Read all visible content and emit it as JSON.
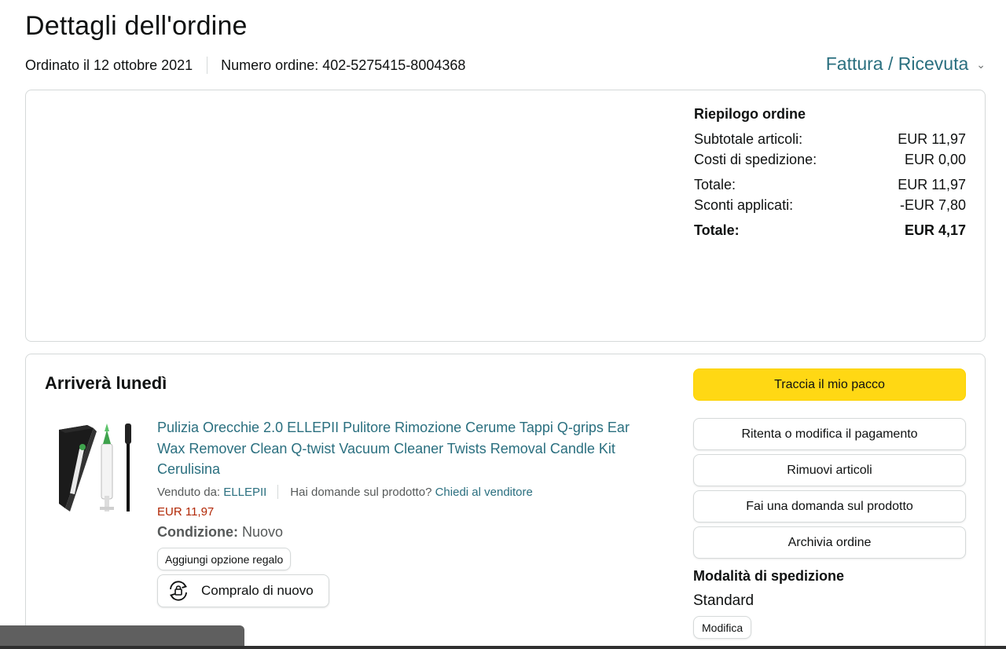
{
  "header": {
    "title": "Dettagli dell'ordine",
    "order_date": "Ordinato il 12 ottobre 2021",
    "order_number": "Numero ordine: 402-5275415-8004368",
    "invoice_link": "Fattura / Ricevuta",
    "invoice_icon": "chevron-down-icon"
  },
  "summary": {
    "title": "Riepilogo ordine",
    "rows": [
      {
        "label": "Subtotale articoli:",
        "value": "EUR 11,97"
      },
      {
        "label": "Costi di spedizione:",
        "value": "EUR 0,00"
      },
      {
        "label": "Totale:",
        "value": "EUR 11,97"
      },
      {
        "label": "Sconti applicati:",
        "value": "-EUR 7,80"
      }
    ],
    "grand_total": {
      "label": "Totale:",
      "value": "EUR 4,17"
    }
  },
  "shipment": {
    "arrival": "Arriverà lunedì",
    "product": {
      "title": "Pulizia Orecchie 2.0 ELLEPII Pulitore Rimozione Cerume Tappi Q-grips Ear Wax Remover Clean Q-twist Vacuum Cleaner Twists Removal Candle Kit Cerulisina",
      "sold_by_label": "Venduto da:",
      "seller": "ELLEPII",
      "question_label": "Hai domande sul prodotto?",
      "ask_seller": "Chiedi al venditore",
      "price": "EUR 11,97",
      "condition_label": "Condizione:",
      "condition_value": "Nuovo",
      "gift_button": "Aggiungi opzione regalo",
      "rebuy_button": "Compralo di nuovo",
      "rebuy_icon": "rebuy-icon"
    },
    "actions": {
      "track": "Traccia il mio pacco",
      "retry_payment": "Ritenta o modifica il pagamento",
      "remove_items": "Rimuovi articoli",
      "ask_question": "Fai una domanda sul prodotto",
      "archive": "Archivia ordine"
    },
    "shipping_method": {
      "title": "Modalità di spedizione",
      "value": "Standard",
      "modify_button": "Modifica"
    }
  },
  "colors": {
    "link": "#2a6f7f",
    "price": "#b12704",
    "primary_button": "#ffd814",
    "border": "#d5d9d9"
  }
}
